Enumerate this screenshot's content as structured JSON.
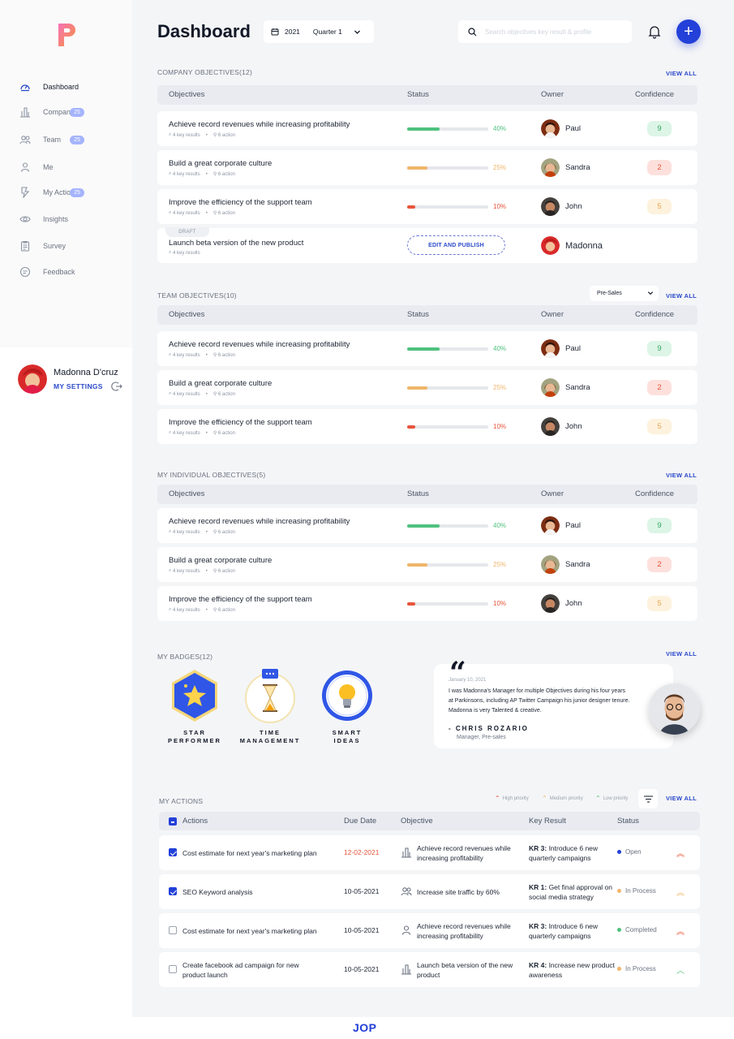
{
  "sidebar": {
    "nav": [
      {
        "label": "Dashboard",
        "icon": "dashboard-icon",
        "badge": ""
      },
      {
        "label": "Company",
        "icon": "company-icon",
        "badge": "25"
      },
      {
        "label": "Team",
        "icon": "team-icon",
        "badge": "25"
      },
      {
        "label": "Me",
        "icon": "user-icon",
        "badge": ""
      },
      {
        "label": "My Actions",
        "icon": "actions-icon",
        "badge": "25"
      },
      {
        "label": "Insights",
        "icon": "eye-icon",
        "badge": ""
      },
      {
        "label": "Survey",
        "icon": "survey-icon",
        "badge": ""
      },
      {
        "label": "Feedback",
        "icon": "feedback-icon",
        "badge": ""
      }
    ],
    "user": {
      "name": "Madonna D'cruz",
      "settings": "MY SETTINGS"
    }
  },
  "header": {
    "title": "Dashboard",
    "year": "2021",
    "quarter": "Quarter 1",
    "search_placeholder": "Search objectives key result & profile"
  },
  "colors": {
    "accent": "#2340d8",
    "green": "#4fc17f",
    "orange": "#f0b56a",
    "red": "#e8553b"
  },
  "table_headers": {
    "objectives": "Objectives",
    "status": "Status",
    "owner": "Owner",
    "confidence": "Confidence"
  },
  "view_all": "VIEW ALL",
  "company": {
    "title": "COMPANY OBJECTIVES(12)",
    "rows": [
      {
        "title": "Achieve record revenues while increasing profitability",
        "kr": "4 key results",
        "action": "6 action",
        "progress": "40%",
        "owner": "Paul",
        "confidence": "9"
      },
      {
        "title": "Build a great corporate culture",
        "kr": "4 key results",
        "action": "6 action",
        "progress": "25%",
        "owner": "Sandra",
        "confidence": "2"
      },
      {
        "title": "Improve the efficiency of the support team",
        "kr": "4 key results",
        "action": "6 action",
        "progress": "10%",
        "owner": "John",
        "confidence": "5"
      }
    ],
    "draft": {
      "tag": "DRAFT",
      "title": "Launch beta version of the new product",
      "kr": "4 key results",
      "button": "EDIT AND PUBLISH",
      "owner": "Madonna"
    }
  },
  "team": {
    "title": "TEAM OBJECTIVES(10)",
    "filter": "Pre-Sales",
    "rows": [
      {
        "title": "Achieve record revenues while increasing profitability",
        "kr": "4 key results",
        "action": "6 action",
        "progress": "40%",
        "owner": "Paul",
        "confidence": "9"
      },
      {
        "title": "Build a great corporate culture",
        "kr": "4 key results",
        "action": "6 action",
        "progress": "25%",
        "owner": "Sandra",
        "confidence": "2"
      },
      {
        "title": "Improve the efficiency of the support team",
        "kr": "4 key results",
        "action": "6 action",
        "progress": "10%",
        "owner": "John",
        "confidence": "5"
      }
    ]
  },
  "individual": {
    "title": "MY INDIVIDUAL OBJECTIVES(5)",
    "rows": [
      {
        "title": "Achieve record revenues while increasing profitability",
        "kr": "4 key results",
        "action": "6 action",
        "progress": "40%",
        "owner": "Paul",
        "confidence": "9"
      },
      {
        "title": "Build a great corporate culture",
        "kr": "4 key results",
        "action": "6 action",
        "progress": "25%",
        "owner": "Sandra",
        "confidence": "2"
      },
      {
        "title": "Improve the efficiency of the support team",
        "kr": "4 key results",
        "action": "6 action",
        "progress": "10%",
        "owner": "John",
        "confidence": "5"
      }
    ]
  },
  "badges": {
    "title": "MY BADGES(12)",
    "items": [
      {
        "line1": "STAR",
        "line2": "PERFORMER",
        "icon": "star-badge-icon"
      },
      {
        "line1": "TIME",
        "line2": "MANAGEMENT",
        "icon": "hourglass-badge-icon"
      },
      {
        "line1": "SMART",
        "line2": "IDEAS",
        "icon": "bulb-badge-icon"
      }
    ]
  },
  "testimonial": {
    "date": "January 10, 2021",
    "text": "I was Madonna's Manager for multiple Objectives during his four years at Parkinsons, including AP Twitter Campaign his junior designer tenure. Madonna is very Talented & creative.",
    "author": "- CHRIS ROZARIO",
    "role": "Manager, Pre-sales"
  },
  "actions": {
    "title": "MY ACTIONS",
    "legend": {
      "high": "High priority",
      "medium": "Medium priority",
      "low": "Low priority"
    },
    "headers": {
      "actions": "Actions",
      "due": "Due Date",
      "objective": "Objective",
      "kr": "Key Result",
      "status": "Status"
    },
    "rows": [
      {
        "checked": true,
        "name": "Cost estimate for next year's marketing plan",
        "due": "12-02-2021",
        "overdue": true,
        "objective": "Achieve record revenues while increasing profitability",
        "obj_icon": "company-icon",
        "kr_label": "KR 3:",
        "kr_text": " Introduce 6 new quarterly campaigns",
        "status": "Open",
        "status_color": "#2340d8",
        "priority": "high"
      },
      {
        "checked": true,
        "name": "SEO Keyword analysis",
        "due": "10-05-2021",
        "overdue": false,
        "objective": "Increase site traffic by 60%",
        "obj_icon": "team-icon",
        "kr_label": "KR 1:",
        "kr_text": " Get final approval on social media strategy",
        "status": "In Process",
        "status_color": "#f0b56a",
        "priority": "medium"
      },
      {
        "checked": false,
        "name": "Cost estimate for next year's marketing plan",
        "due": "10-05-2021",
        "overdue": false,
        "objective": "Achieve record revenues while increasing profitability",
        "obj_icon": "user-icon",
        "kr_label": "KR 3:",
        "kr_text": " Introduce 6 new quarterly campaigns",
        "status": "Completed",
        "status_color": "#4fc17f",
        "priority": "high"
      },
      {
        "checked": false,
        "name": "Create facebook ad campaign for new product launch",
        "due": "10-05-2021",
        "overdue": false,
        "objective": "Launch beta version of the new product",
        "obj_icon": "company-icon",
        "kr_label": "KR 4:",
        "kr_text": " Increase new product awareness",
        "status": "In Process",
        "status_color": "#f0b56a",
        "priority": "low"
      }
    ]
  },
  "footer": {
    "logo": "JOP"
  }
}
